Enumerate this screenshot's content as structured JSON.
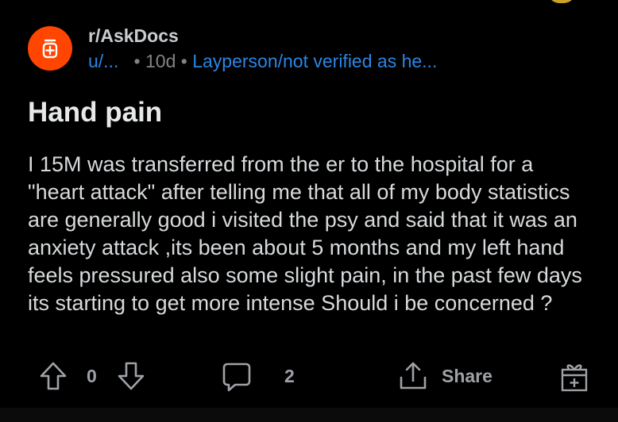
{
  "post": {
    "subreddit": "r/AskDocs",
    "author": "u/...",
    "age": "10d",
    "flair": "Layperson/not verified as he...",
    "title": "Hand pain",
    "body": "I 15M was transferred from the er to the hospital for a \"heart attack\" after telling me that all of my body statistics are generally good i visited the psy and said that it was an anxiety attack ,its been about 5 months and my left hand feels pressured also some slight pain, in the past few days its starting to get more intense Should i be concerned ?"
  },
  "actions": {
    "vote_count": "0",
    "comment_count": "2",
    "share_label": "Share"
  },
  "colors": {
    "subreddit_icon_bg": "#ff4500",
    "link_blue": "#2b86e3",
    "background": "#000000"
  },
  "icons": [
    "subreddit-avatar-icon",
    "upvote-icon",
    "downvote-icon",
    "comment-icon",
    "share-icon",
    "award-icon"
  ]
}
